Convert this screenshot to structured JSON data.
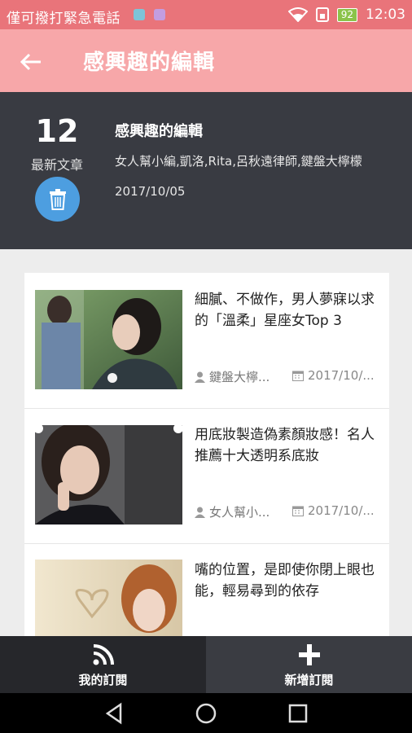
{
  "status": {
    "carrier": "僅可撥打緊急電話",
    "battery": "92",
    "time": "12:03"
  },
  "appbar": {
    "title": "感興趣的編輯"
  },
  "header": {
    "count": "12",
    "count_label": "最新文章",
    "title": "感興趣的編輯",
    "subtitle": "女人幫小編,凱洛,Rita,呂秋遠律師,鍵盤大檸檬",
    "date": "2017/10/05"
  },
  "articles": [
    {
      "title": "細膩、不做作，男人夢寐以求的「溫柔」星座女Top 3",
      "author": "鍵盤大檸...",
      "date": "2017/10/..."
    },
    {
      "title": "用底妝製造偽素顏妝感！名人推薦十大透明系底妝",
      "author": "女人幫小...",
      "date": "2017/10/..."
    },
    {
      "title": "嘴的位置，是即使你閉上眼也能，輕易尋到的依存",
      "author": "",
      "date": ""
    }
  ],
  "bottom_tabs": [
    {
      "label": "我的訂閱",
      "icon": "rss-icon"
    },
    {
      "label": "新增訂閱",
      "icon": "plus-icon"
    }
  ],
  "colors": {
    "status": "#e9747a",
    "appbar": "#f7a7a9",
    "header": "#393b42",
    "trash": "#4d9ee0"
  }
}
